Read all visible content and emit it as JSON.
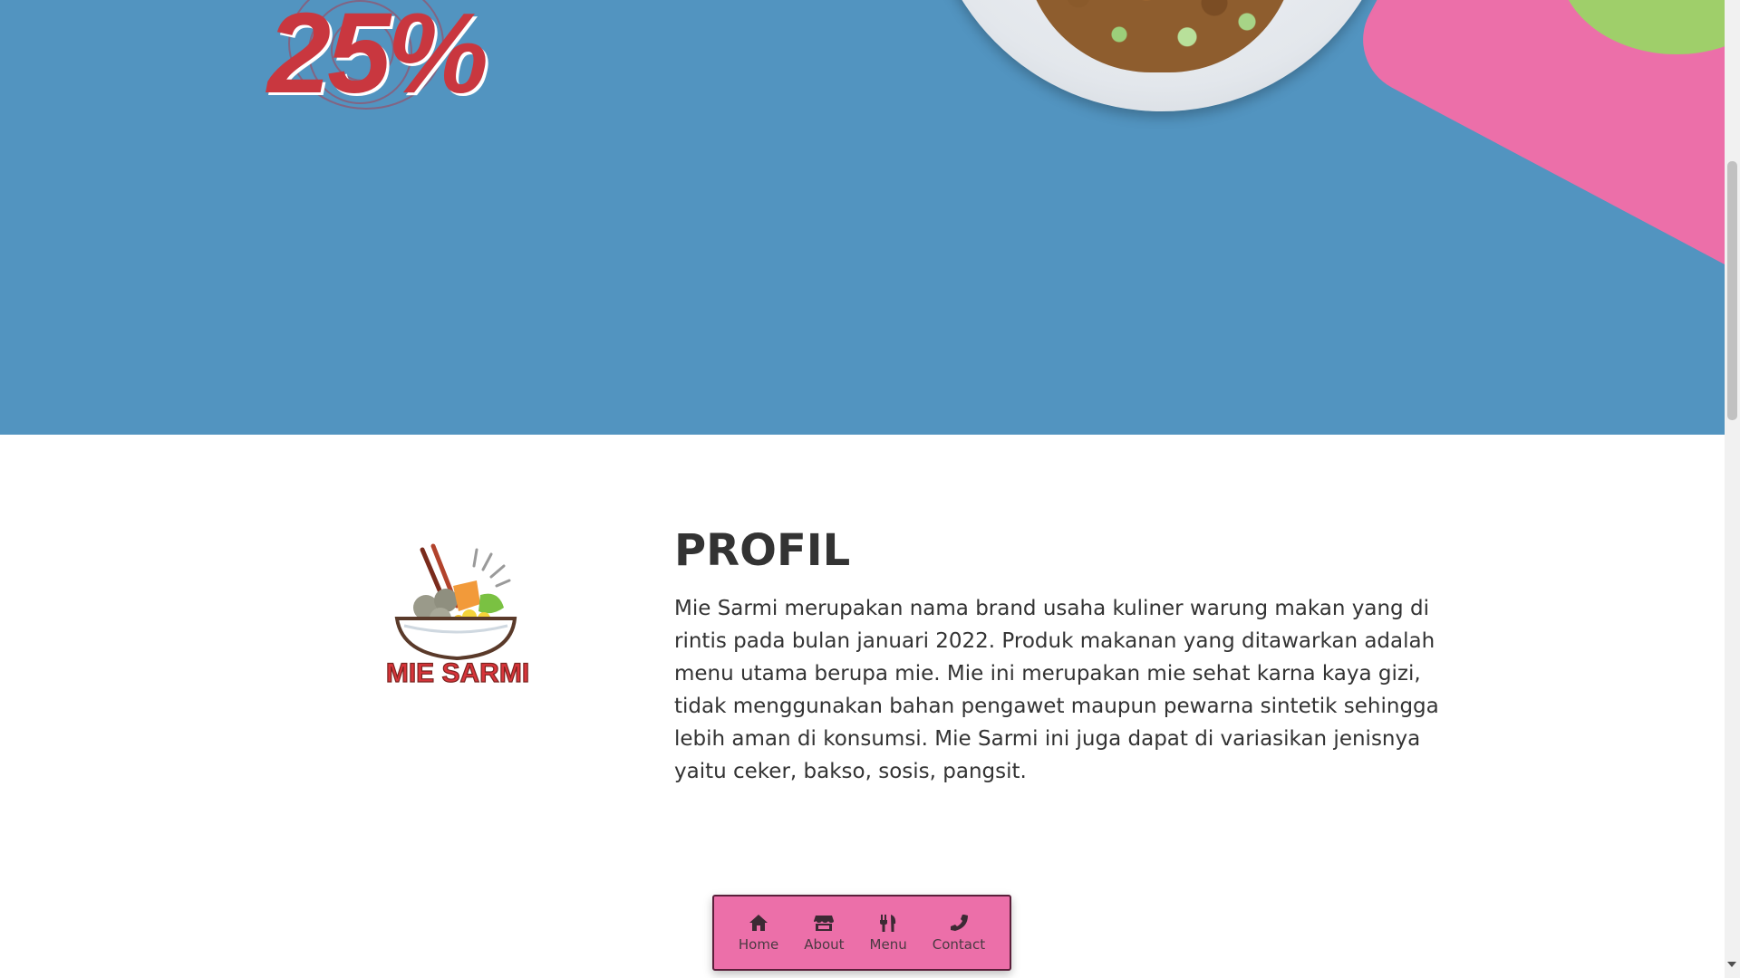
{
  "hero": {
    "discount_text": "25%",
    "background_color": "#5294c0",
    "accent_pink": "#ec6fa9",
    "accent_green": "#9fcf6a"
  },
  "profile": {
    "logo_text": "MIE SARMI",
    "title": "PROFIL",
    "body": "Mie Sarmi merupakan nama brand usaha kuliner warung makan yang di rintis pada bulan januari 2022. Produk makanan yang ditawarkan adalah menu utama berupa mie. Mie ini merupakan mie sehat karna kaya gizi, tidak menggunakan bahan pengawet maupun pewarna sintetik sehingga lebih aman di konsumsi. Mie Sarmi ini juga dapat di variasikan jenisnya yaitu ceker, bakso, sosis, pangsit."
  },
  "nav": {
    "items": [
      {
        "label": "Home",
        "icon": "home-icon"
      },
      {
        "label": "About",
        "icon": "store-icon"
      },
      {
        "label": "Menu",
        "icon": "utensils-icon"
      },
      {
        "label": "Contact",
        "icon": "phone-icon"
      }
    ],
    "background_color": "#ec6fa9"
  }
}
